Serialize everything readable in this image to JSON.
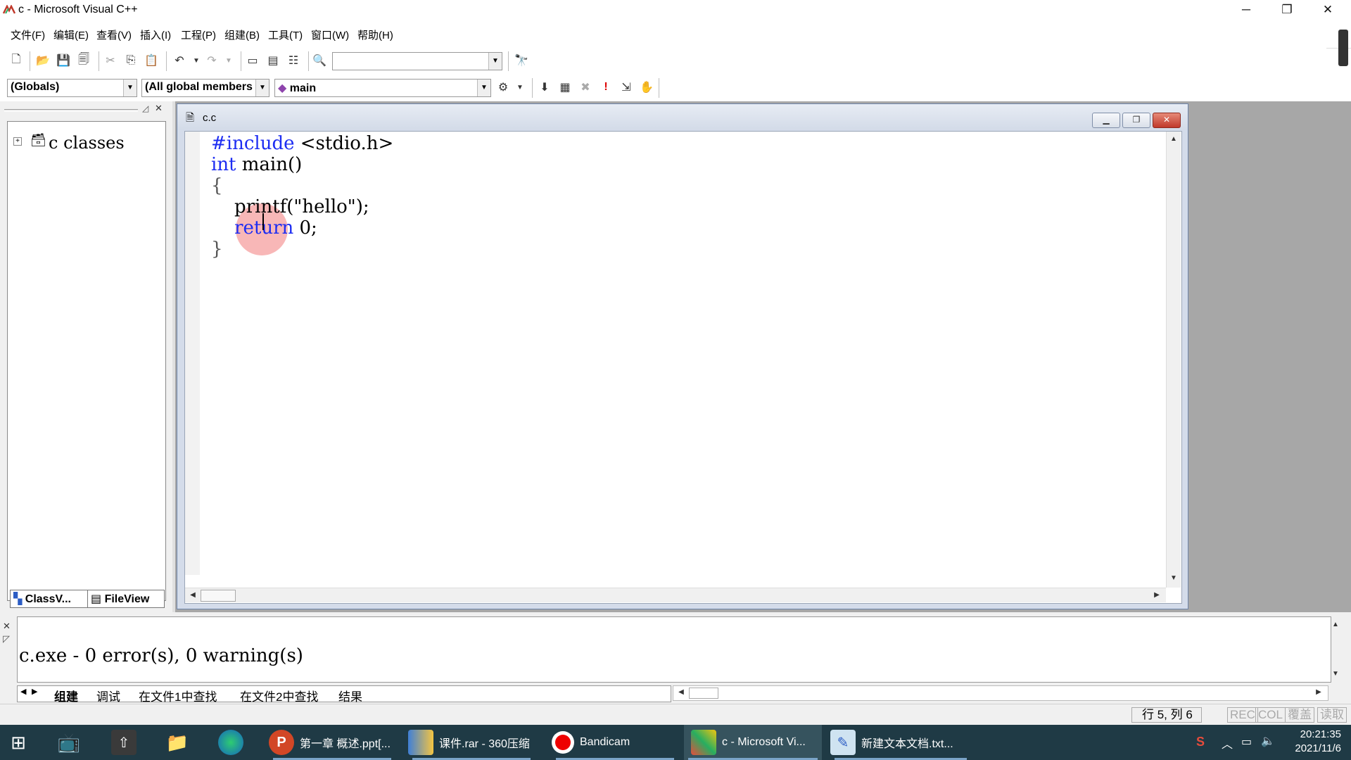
{
  "window": {
    "title": "c - Microsoft Visual C++",
    "minimize": "─",
    "restore": "❐",
    "close": "✕"
  },
  "menu": [
    "文件(F)",
    "编辑(E)",
    "查看(V)",
    "插入(I)",
    "工程(P)",
    "组建(B)",
    "工具(T)",
    "窗口(W)",
    "帮助(H)"
  ],
  "toolbar2": {
    "scope_combo": "(Globals)",
    "members_combo": "(All global members",
    "function_combo": "main"
  },
  "workspace": {
    "tree_root": "c classes",
    "tabs": [
      "ClassV...",
      "FileView"
    ]
  },
  "document": {
    "title": "c.c",
    "code": {
      "line1_kw": "#include",
      "line1_rest": " <stdio.h>",
      "line2_kw": "int",
      "line2_rest": " main()",
      "line3": "{",
      "line4": "    printf(\"hello\");",
      "line5_kw": "return",
      "line5_rest": " 0;",
      "line6": "}"
    }
  },
  "output": {
    "text": "c.exe - 0 error(s), 0 warning(s)",
    "tabs": [
      "组建",
      "调试",
      "在文件1中查找",
      "在文件2中查找",
      "结果"
    ]
  },
  "status": {
    "position": "行 5, 列 6",
    "indicators": [
      "REC",
      "COL",
      "覆盖",
      "读取"
    ]
  },
  "taskbar": {
    "items": [
      {
        "label": "第一章 概述.ppt[...",
        "icon": "powerpoint-icon"
      },
      {
        "label": "课件.rar - 360压缩",
        "icon": "archive-icon"
      },
      {
        "label": "Bandicam",
        "icon": "record-icon"
      },
      {
        "label": "c - Microsoft Vi...",
        "icon": "visual-cpp-icon"
      },
      {
        "label": "新建文本文档.txt...",
        "icon": "notepad-icon"
      }
    ],
    "time": "20:21:35",
    "date": "2021/11/6"
  },
  "colors": {
    "keyword": "#1d2df2",
    "taskbar": "#1f3a45"
  }
}
